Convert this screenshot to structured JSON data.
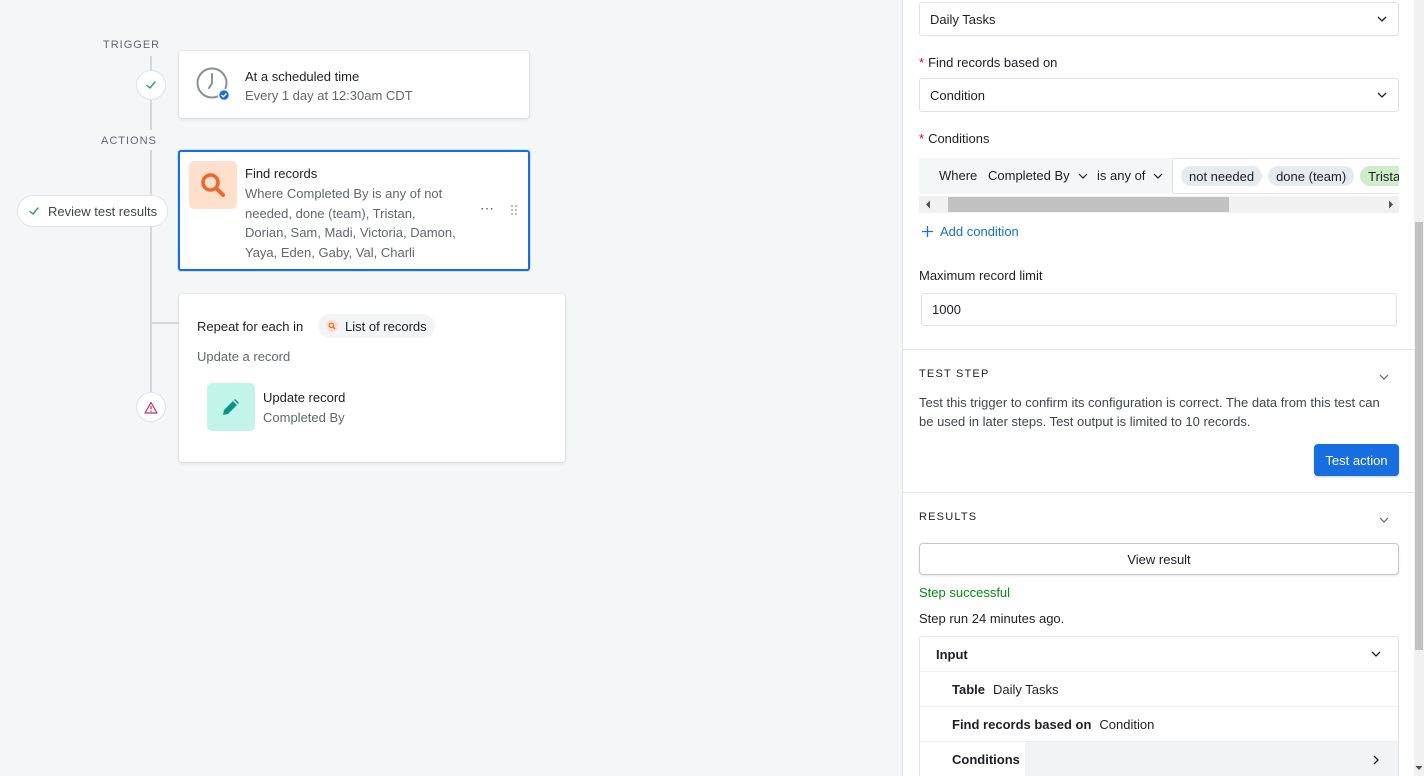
{
  "canvas": {
    "trigger_label": "TRIGGER",
    "actions_label": "ACTIONS",
    "trigger_card": {
      "title": "At a scheduled time",
      "subtitle": "Every 1 day at 12:30am CDT"
    },
    "find_card": {
      "title": "Find records",
      "lines": [
        "Where Completed By is any of not",
        "needed, done (team), Tristan,",
        "Dorian, Sam, Madi, Victoria, Damon,",
        "Yaya, Eden, Gaby, Val, Charli"
      ],
      "more": "⋯"
    },
    "review_button": "Review test results",
    "repeat_card": {
      "title": "Repeat for each in",
      "list_chip": "List of records",
      "subtitle": "Update a record",
      "inner_title": "Update record",
      "inner_sub": "Completed By"
    }
  },
  "panel": {
    "table_value": "Daily Tasks",
    "find_based_label": "Find records based on",
    "find_based_value": "Condition",
    "conditions_label": "Conditions",
    "condition": {
      "where": "Where",
      "field": "Completed By",
      "operator": "is any of",
      "chips": [
        "not needed",
        "done (team)",
        "Tristan"
      ]
    },
    "add_condition": "Add condition",
    "max_limit_label": "Maximum record limit",
    "max_limit_value": "1000",
    "test_step_head": "TEST STEP",
    "test_step_text_1": "Test this trigger to confirm its configuration is correct. The data from this test can",
    "test_step_text_2": "be used in later steps. Test output is limited to 10 records.",
    "test_button": "Test action",
    "results_head": "RESULTS",
    "view_result": "View result",
    "step_status": "Step successful",
    "step_run": "Step run 24 minutes ago.",
    "input": {
      "header": "Input",
      "rows": [
        {
          "key": "Table",
          "value": "Daily Tasks"
        },
        {
          "key": "Find records based on",
          "value": "Condition"
        },
        {
          "key": "Conditions",
          "value": ""
        }
      ]
    }
  },
  "colors": {
    "accent": "#166ee1",
    "success": "#048a0e",
    "find_icon_bg": "#ffe0cc",
    "find_icon": "#f0642e",
    "update_icon_bg": "#c2f5e9",
    "update_icon": "#0d9488",
    "warning": "#c22d64"
  }
}
